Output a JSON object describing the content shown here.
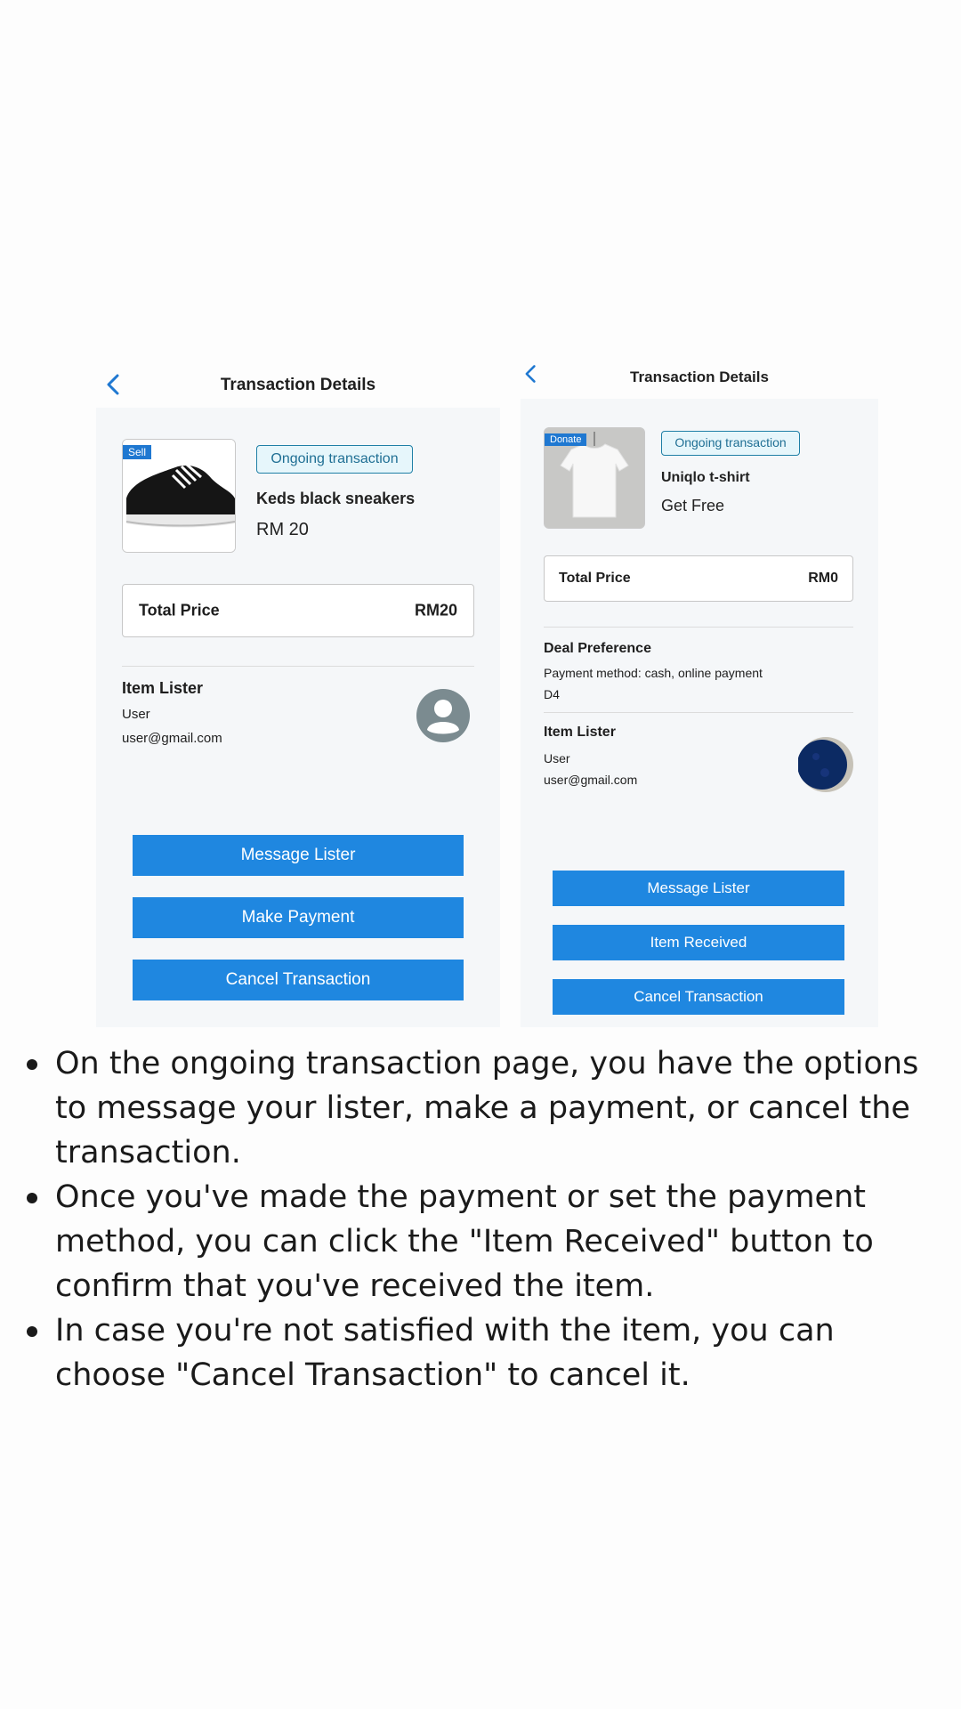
{
  "left_screen": {
    "header": {
      "title": "Transaction Details",
      "back_icon": "chevron-left-icon"
    },
    "item": {
      "tag": "Sell",
      "status": "Ongoing transaction",
      "name": "Keds black sneakers",
      "price": "RM 20",
      "image": "black-sneaker-image"
    },
    "total": {
      "label": "Total Price",
      "value": "RM20"
    },
    "lister": {
      "title": "Item Lister",
      "name": "User",
      "email": "user@gmail.com",
      "avatar": "user-avatar-icon"
    },
    "buttons": {
      "message": "Message Lister",
      "payment": "Make Payment",
      "cancel": "Cancel Transaction"
    }
  },
  "right_screen": {
    "header": {
      "title": "Transaction Details",
      "back_icon": "chevron-left-icon"
    },
    "item": {
      "tag": "Donate",
      "status": "Ongoing transaction",
      "name": "Uniqlo t-shirt",
      "price": "Get Free",
      "image": "white-tshirt-image"
    },
    "total": {
      "label": "Total Price",
      "value": "RM0"
    },
    "deal": {
      "title": "Deal Preference",
      "method": "Payment method: cash, online payment",
      "location": "D4"
    },
    "lister": {
      "title": "Item Lister",
      "name": "User",
      "email": "user@gmail.com",
      "avatar": "moon-avatar-image"
    },
    "buttons": {
      "message": "Message Lister",
      "received": "Item Received",
      "cancel": "Cancel Transaction"
    }
  },
  "instructions": [
    "On the ongoing transaction page, you have the options to message your lister, make a payment, or cancel the transaction.",
    "Once you've made the payment or set the payment method, you can click the \"Item Received\" button to confirm that you've received the item.",
    "In case you're not satisfied with the item, you can choose \"Cancel Transaction\" to cancel it."
  ],
  "colors": {
    "accent": "#1f87e0",
    "badge_border": "#1f7fa6",
    "screen_bg": "#f5f7f9"
  }
}
